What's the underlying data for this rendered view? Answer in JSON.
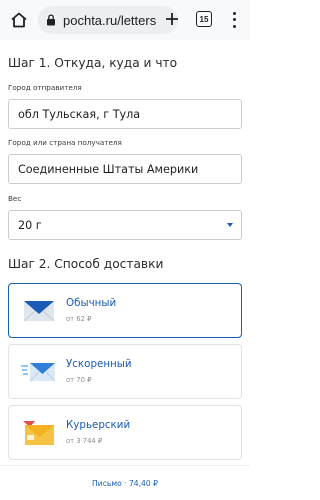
{
  "browser": {
    "url": "pochta.ru/letters",
    "tab_count": "15"
  },
  "form": {
    "step1_title": "Шаг 1. Откуда, куда и что",
    "sender_city": {
      "label": "Город отправителя",
      "value": "обл Тульская, г Тула"
    },
    "recipient": {
      "label": "Город или страна получателя",
      "value": "Соединенные Штаты Америки"
    },
    "weight": {
      "label": "Вес",
      "value": "20 г"
    },
    "step2_title": "Шаг 2. Способ доставки"
  },
  "delivery_options": [
    {
      "name": "Обычный",
      "price": "от 62 ₽",
      "selected": true,
      "icon": "plain-envelope-icon"
    },
    {
      "name": "Ускоренный",
      "price": "от 70 ₽",
      "selected": false,
      "icon": "express-envelope-icon"
    },
    {
      "name": "Курьерский",
      "price": "от 3 744 ₽",
      "selected": false,
      "icon": "courier-envelope-icon"
    }
  ],
  "summary": {
    "text": "Письмо · 74,40 ₽"
  },
  "colors": {
    "accent": "#1a5bb5",
    "selected_border": "#1a5bb5",
    "courier_yellow": "#f6c343"
  }
}
